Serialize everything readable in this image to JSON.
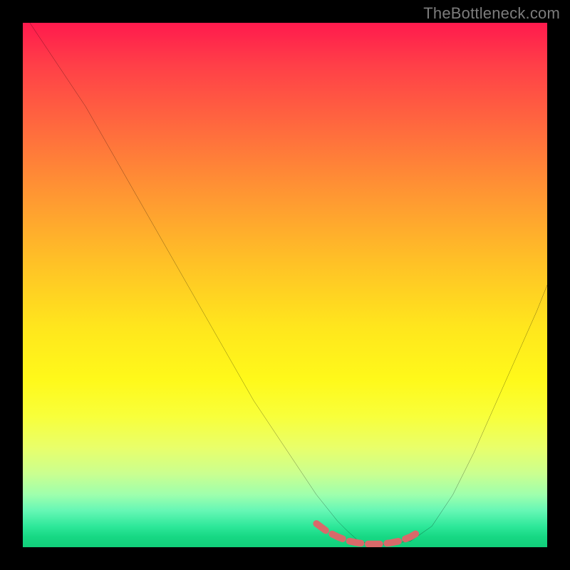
{
  "watermark": "TheBottleneck.com",
  "chart_data": {
    "type": "line",
    "title": "",
    "xlabel": "",
    "ylabel": "",
    "xlim": [
      0,
      100
    ],
    "ylim": [
      0,
      100
    ],
    "series": [
      {
        "name": "bottleneck-curve",
        "color": "#000000",
        "x": [
          0,
          4,
          8,
          12,
          16,
          20,
          24,
          28,
          32,
          36,
          40,
          44,
          48,
          52,
          56,
          60,
          62,
          64,
          66,
          68,
          70,
          74,
          78,
          82,
          86,
          90,
          94,
          98,
          100
        ],
        "y": [
          102,
          96,
          90,
          84,
          77,
          70,
          63,
          56,
          49,
          42,
          35,
          28,
          22,
          16,
          10,
          5,
          3,
          1.2,
          0.6,
          0.5,
          0.6,
          1.2,
          4,
          10,
          18,
          27,
          36,
          45,
          50
        ]
      },
      {
        "name": "highlight-band",
        "color": "#d86a6a",
        "x": [
          56,
          58,
          60,
          62,
          64,
          66,
          68,
          70,
          72,
          74,
          76
        ],
        "y": [
          4.5,
          3.0,
          2.0,
          1.2,
          0.8,
          0.6,
          0.6,
          0.8,
          1.2,
          2.0,
          3.2
        ]
      }
    ],
    "background_gradient": {
      "top": "#ff1a4d",
      "mid": "#ffe61d",
      "bottom": "#11cf7a"
    }
  }
}
